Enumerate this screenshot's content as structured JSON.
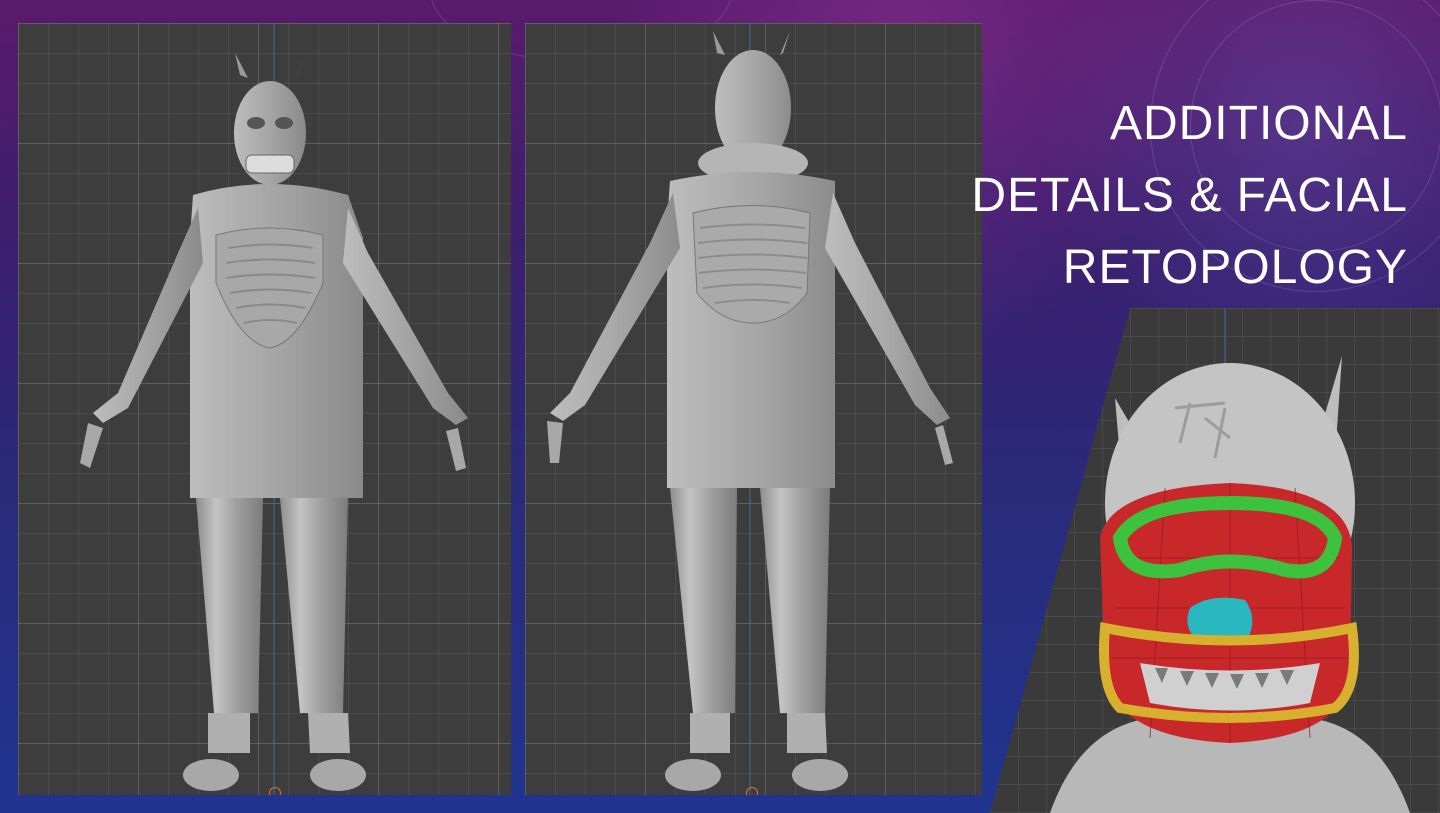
{
  "slide": {
    "title_lines": [
      "ADDITIONAL",
      "DETAILS & FACIAL",
      "RETOPOLOGY"
    ]
  },
  "panels": {
    "front": {
      "label": "front-view"
    },
    "back": {
      "label": "back-view"
    },
    "face": {
      "label": "face-retopology-view",
      "colors": {
        "mask": "#c8282a",
        "eye_loop": "#3cc23c",
        "nose": "#2ab8c0",
        "mouth_loop": "#d8b030"
      }
    }
  },
  "colors": {
    "viewport_bg": "#3d3d3d",
    "model_gray": "#9e9e9e",
    "title_text": "#ffffff"
  }
}
